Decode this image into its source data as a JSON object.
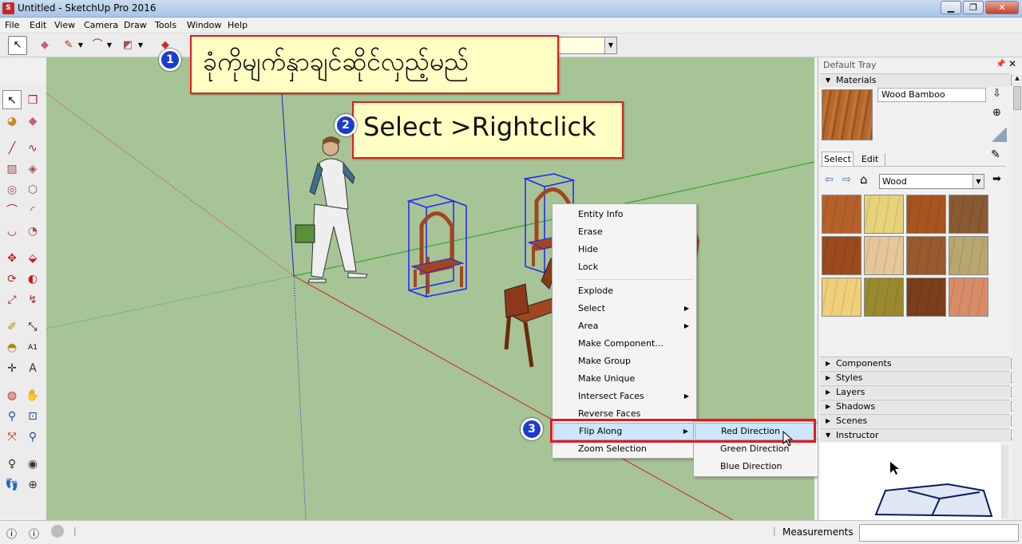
{
  "window": {
    "title": "Untitled - SketchUp Pro 2016",
    "app_icon": "sketchup-logo",
    "buttons": {
      "minimize": "▁",
      "restore": "❐",
      "close": "✕"
    }
  },
  "menu": [
    "File",
    "Edit",
    "View",
    "Camera",
    "Draw",
    "Tools",
    "Window",
    "Help"
  ],
  "annotations": {
    "step1": {
      "number": "1",
      "text": "ခုံကိုမျက်နှာချင်ဆိုင်လှည့်မည်"
    },
    "step2": {
      "number": "2",
      "text": "Select >Rightclick"
    },
    "step3": {
      "number": "3"
    }
  },
  "context_menu": {
    "items": [
      {
        "label": "Entity Info",
        "submenu": false
      },
      {
        "label": "Erase",
        "submenu": false
      },
      {
        "label": "Hide",
        "submenu": false
      },
      {
        "label": "Lock",
        "submenu": false
      },
      {
        "label": "Explode",
        "submenu": false
      },
      {
        "label": "Select",
        "submenu": true
      },
      {
        "label": "Area",
        "submenu": true
      },
      {
        "label": "Make Component...",
        "submenu": false
      },
      {
        "label": "Make Group",
        "submenu": false
      },
      {
        "label": "Make Unique",
        "submenu": false
      },
      {
        "label": "Intersect Faces",
        "submenu": true
      },
      {
        "label": "Reverse Faces",
        "submenu": false
      },
      {
        "label": "Flip Along",
        "submenu": true,
        "highlighted": true
      },
      {
        "label": "Zoom Selection",
        "submenu": false
      }
    ],
    "submenu": [
      {
        "label": "Red Direction",
        "highlighted": true
      },
      {
        "label": "Green Direction"
      },
      {
        "label": "Blue Direction"
      }
    ]
  },
  "tray": {
    "title": "Default Tray",
    "materials": {
      "header": "Materials",
      "current_name": "Wood Bamboo",
      "tabs": [
        "Select",
        "Edit"
      ],
      "library": "Wood",
      "swatch_colors": [
        "#b5612a",
        "#e7d27a",
        "#a8541e",
        "#8a5a32",
        "#9b4a1c",
        "#e6c79c",
        "#9a5a2c",
        "#b8a670",
        "#f0cf7c",
        "#9a8a2e",
        "#7a3e1a",
        "#d88d68"
      ]
    },
    "panels": [
      "Components",
      "Styles",
      "Layers",
      "Shadows",
      "Scenes",
      "Instructor"
    ]
  },
  "status": {
    "measurements_label": "Measurements",
    "measurements_value": ""
  },
  "colors": {
    "annotation_border": "#e21b1b",
    "annotation_fill": "#ffffc4",
    "badge": "#1b3ccf",
    "viewport_bg": "#a6c495",
    "selection": "#1f1fff"
  }
}
